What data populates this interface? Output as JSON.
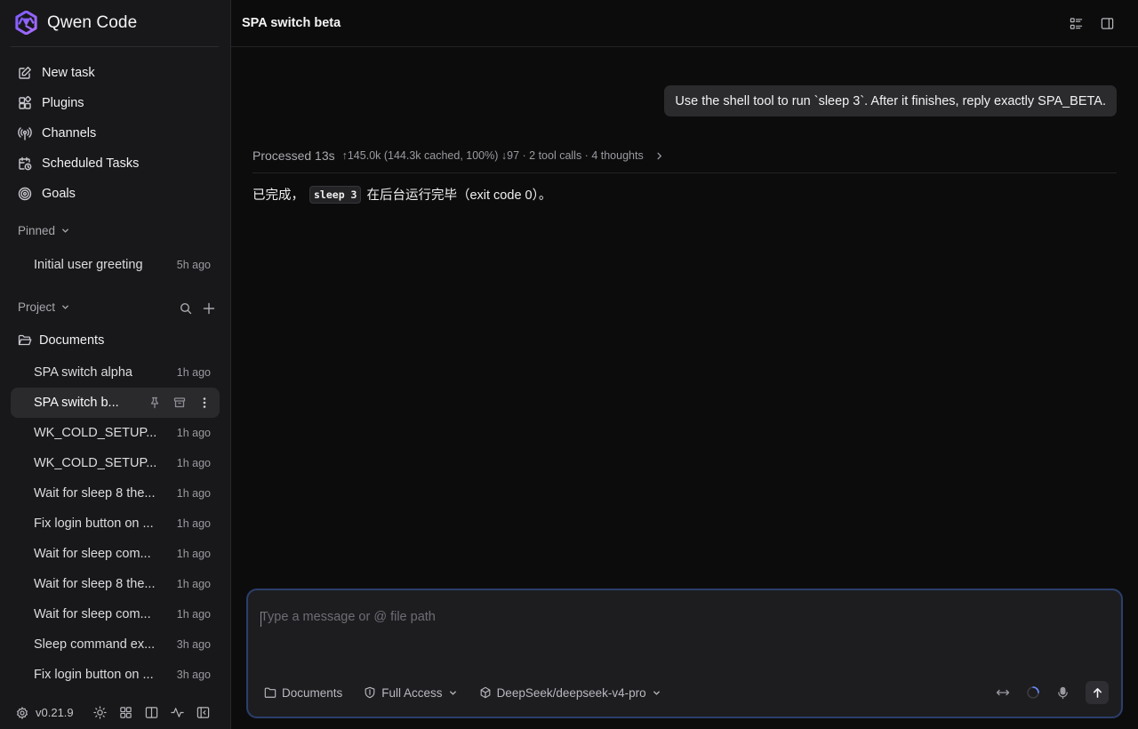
{
  "app": {
    "name": "Qwen Code",
    "version": "v0.21.9"
  },
  "nav": [
    {
      "label": "New task",
      "icon": "edit-icon"
    },
    {
      "label": "Plugins",
      "icon": "plugins-icon"
    },
    {
      "label": "Channels",
      "icon": "broadcast-icon"
    },
    {
      "label": "Scheduled Tasks",
      "icon": "calendar-clock-icon"
    },
    {
      "label": "Goals",
      "icon": "target-icon"
    }
  ],
  "pinned": {
    "label": "Pinned",
    "items": [
      {
        "title": "Initial user greeting",
        "time": "5h ago"
      }
    ]
  },
  "project": {
    "label": "Project",
    "folder": "Documents",
    "items": [
      {
        "title": "SPA switch alpha",
        "time": "1h ago"
      },
      {
        "title": "SPA switch b...",
        "time": ""
      },
      {
        "title": "WK_COLD_SETUP...",
        "time": "1h ago"
      },
      {
        "title": "WK_COLD_SETUP...",
        "time": "1h ago"
      },
      {
        "title": "Wait for sleep 8 the...",
        "time": "1h ago"
      },
      {
        "title": "Fix login button on ...",
        "time": "1h ago"
      },
      {
        "title": "Wait for sleep com...",
        "time": "1h ago"
      },
      {
        "title": "Wait for sleep 8 the...",
        "time": "1h ago"
      },
      {
        "title": "Wait for sleep com...",
        "time": "1h ago"
      },
      {
        "title": "Sleep command ex...",
        "time": "3h ago"
      },
      {
        "title": "Fix login button on ...",
        "time": "3h ago"
      }
    ]
  },
  "header": {
    "title": "SPA switch beta"
  },
  "conversation": {
    "user_message": "Use the shell tool to run `sleep 3`. After it finishes, reply exactly SPA_BETA.",
    "processed_label": "Processed 13s",
    "processed_meta": "↑145.0k (144.3k cached, 100%) ↓97 · 2 tool calls · 4 thoughts",
    "reply_prefix": "已完成，",
    "reply_code": "sleep 3",
    "reply_suffix": "在后台运行完毕（exit code 0）。"
  },
  "composer": {
    "placeholder": "Type a message or @ file path",
    "folder": "Documents",
    "access": "Full Access",
    "model": "DeepSeek/deepseek-v4-pro"
  },
  "colors": {
    "background": "#0c0c0d",
    "sidebar": "#18181a",
    "composer_border": "#2c3f6b",
    "brand_gradient": [
      "#6a4cff",
      "#a46bff"
    ]
  }
}
